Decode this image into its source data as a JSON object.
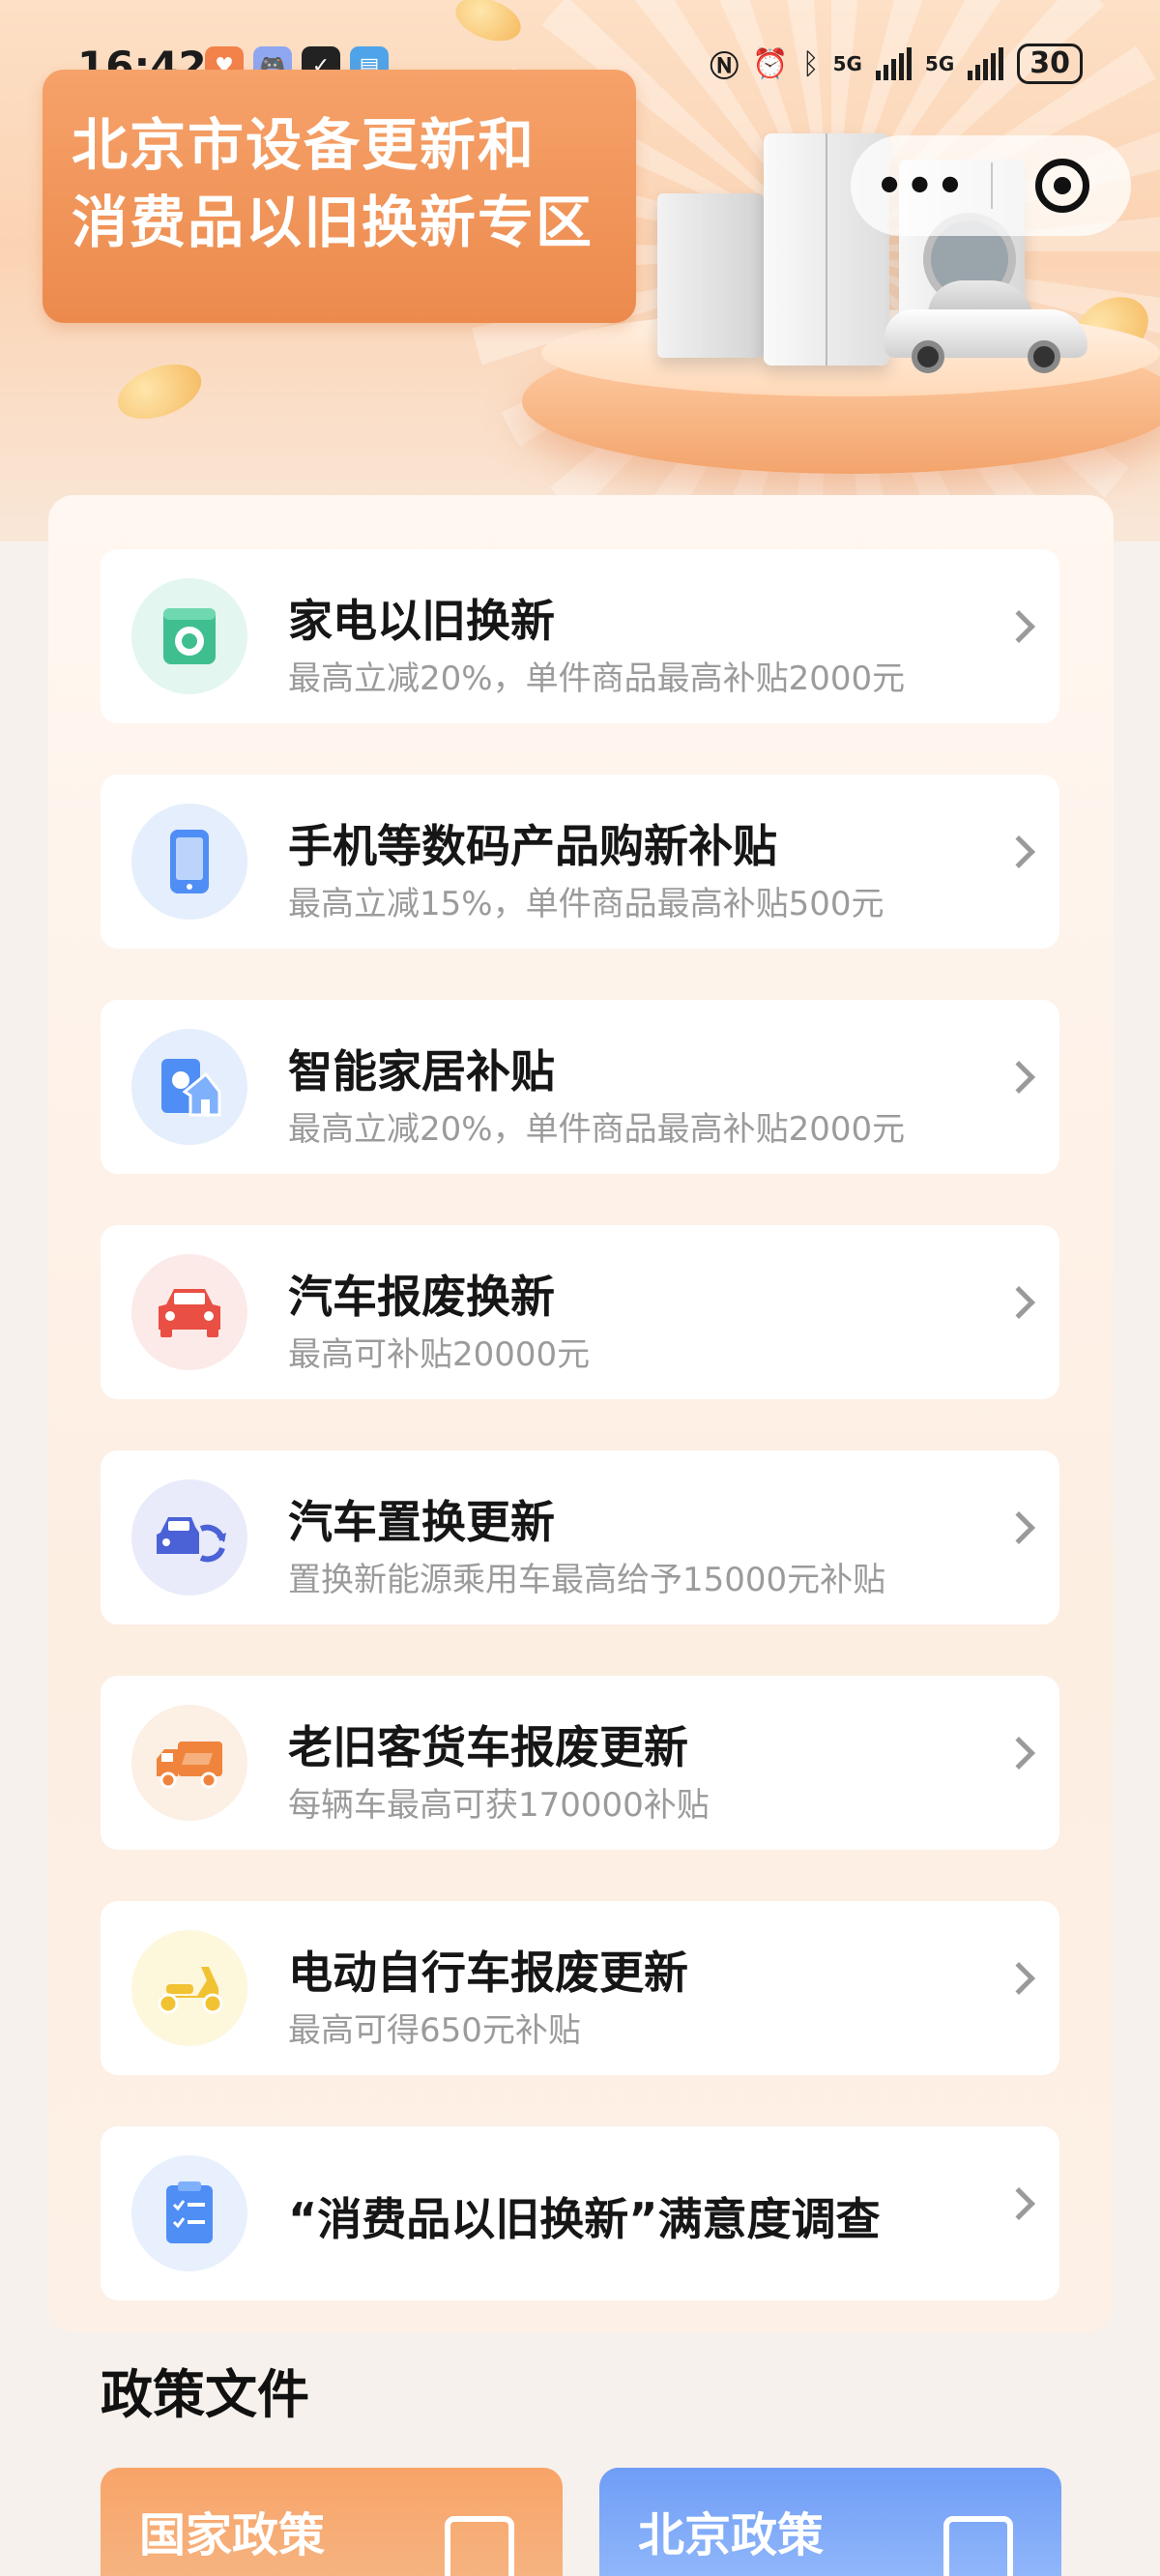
{
  "status_bar": {
    "time": "16:42",
    "network_1": "5G",
    "network_2": "5G",
    "battery": "30"
  },
  "header": {
    "title_line1": "北京市设备更新和",
    "title_line2": "消费品以旧换新专区",
    "more_label": "•••"
  },
  "items": [
    {
      "title": "家电以旧换新",
      "subtitle": "最高立减20%，单件商品最高补贴2000元",
      "icon": "washing-machine-icon",
      "icon_bg": "#e3f6ef",
      "icon_color": "#3fbf8f"
    },
    {
      "title": "手机等数码产品购新补贴",
      "subtitle": "最高立减15%，单件商品最高补贴500元",
      "icon": "phone-icon",
      "icon_bg": "#e5eefc",
      "icon_color": "#4f8ef5"
    },
    {
      "title": "智能家居补贴",
      "subtitle": "最高立减20%，单件商品最高补贴2000元",
      "icon": "smart-home-icon",
      "icon_bg": "#e5eefc",
      "icon_color": "#4f8ef5"
    },
    {
      "title": "汽车报废换新",
      "subtitle": "最高可补贴20000元",
      "icon": "car-icon",
      "icon_bg": "#fbeae8",
      "icon_color": "#e94f43"
    },
    {
      "title": "汽车置换更新",
      "subtitle": "置换新能源乘用车最高给予15000元补贴",
      "icon": "car-swap-icon",
      "icon_bg": "#e9ebfb",
      "icon_color": "#4b62d6"
    },
    {
      "title": "老旧客货车报废更新",
      "subtitle": "每辆车最高可获170000补贴",
      "icon": "truck-icon",
      "icon_bg": "#fcefe4",
      "icon_color": "#f0843d"
    },
    {
      "title": "电动自行车报废更新",
      "subtitle": "最高可得650元补贴",
      "icon": "scooter-icon",
      "icon_bg": "#fdf7dc",
      "icon_color": "#f1c232"
    },
    {
      "title": "“消费品以旧换新”满意度调查",
      "subtitle": "",
      "icon": "survey-icon",
      "icon_bg": "#e7f0fc",
      "icon_color": "#4f8ef5"
    }
  ],
  "policy": {
    "section_title": "政策文件",
    "national_label": "国家政策",
    "beijing_label": "北京政策"
  }
}
